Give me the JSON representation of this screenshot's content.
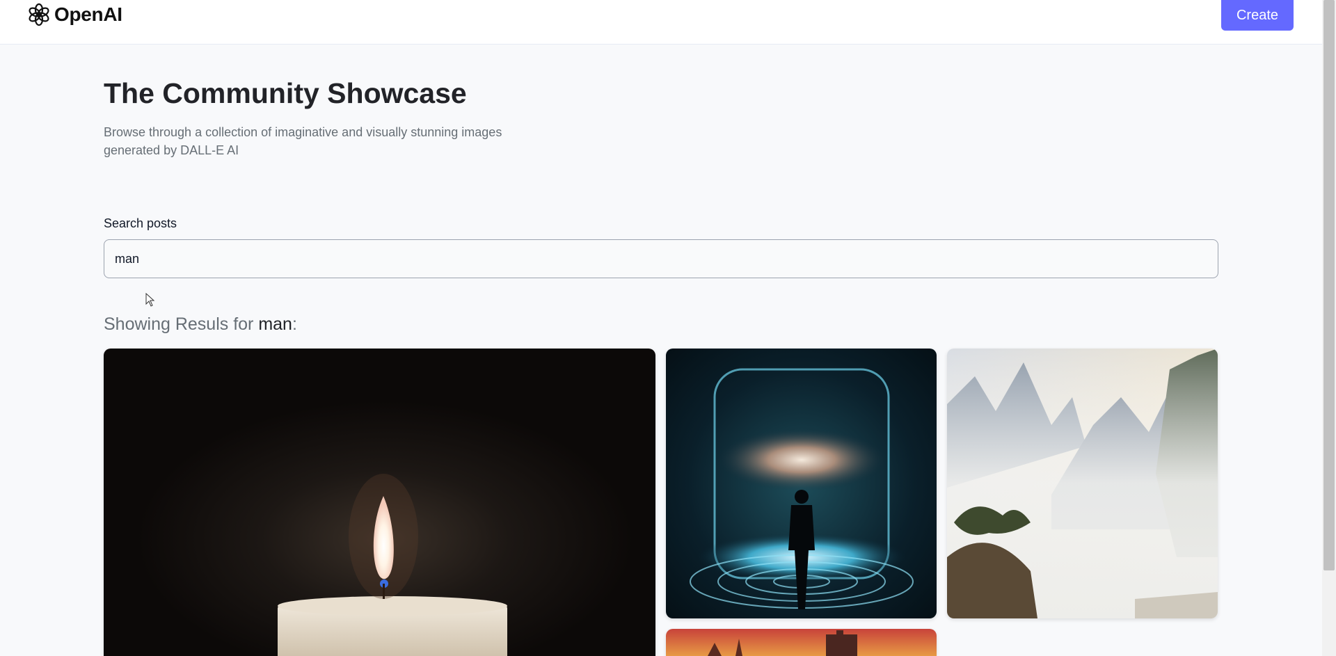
{
  "header": {
    "logo_text": "OpenAI",
    "create_label": "Create",
    "accent": "#6469ff"
  },
  "page": {
    "title": "The Community Showcase",
    "subtitle": "Browse through a collection of imaginative and visually stunning images generated by DALL-E AI"
  },
  "search": {
    "label": "Search posts",
    "value": "man"
  },
  "results": {
    "prefix": "Showing Resuls for ",
    "term": "man",
    "suffix": ":"
  },
  "cards": [
    {
      "icon": "candle-image"
    },
    {
      "icon": "galaxy-portal-image"
    },
    {
      "icon": "misty-mountains-image"
    },
    {
      "icon": "castle-sunset-image"
    }
  ]
}
